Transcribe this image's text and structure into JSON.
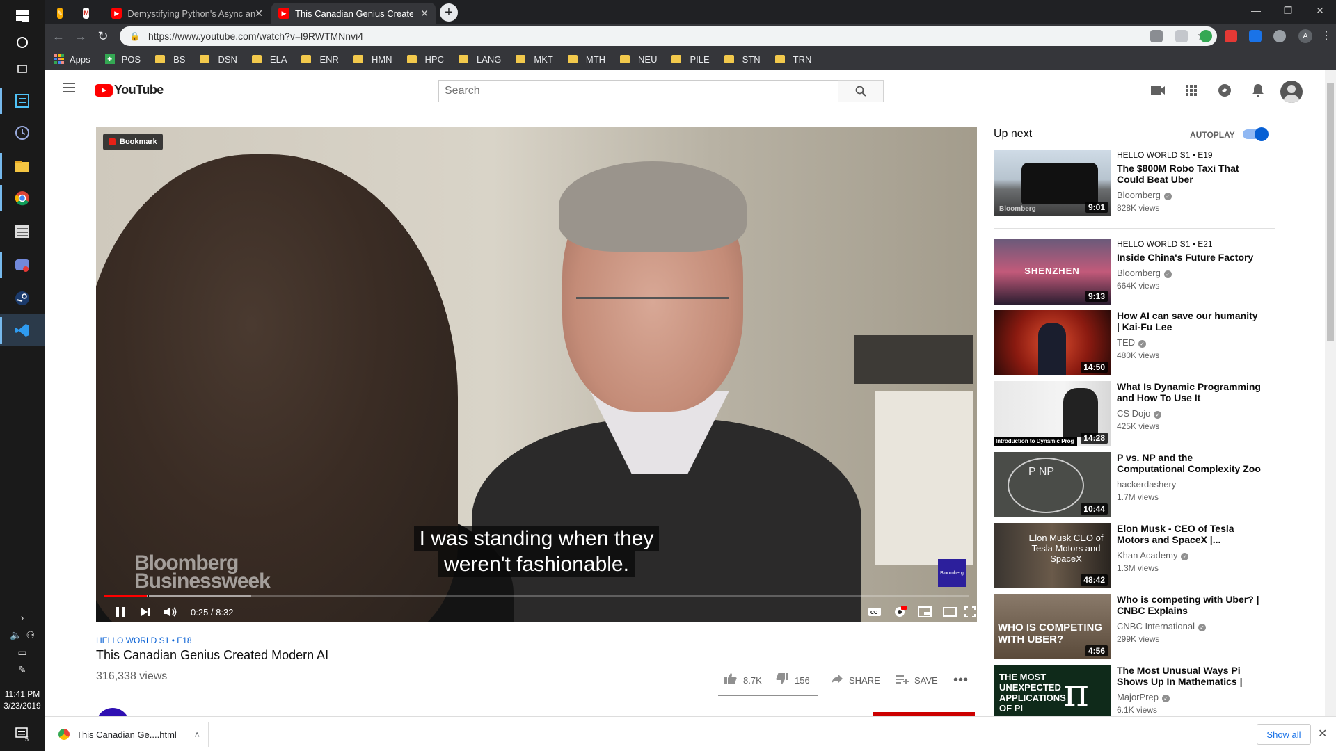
{
  "taskbar": {
    "time": "11:41 PM",
    "date": "3/23/2019",
    "notification_count": "5"
  },
  "browser": {
    "tabs": [
      {
        "label": "",
        "icon": "keep-icon"
      },
      {
        "label": "",
        "icon": "gmail-icon"
      },
      {
        "label": "Demystifying Python's Async and",
        "icon": "youtube-icon"
      },
      {
        "label": "This Canadian Genius Create",
        "icon": "youtube-icon"
      }
    ],
    "url": "https://www.youtube.com/watch?v=l9RWTMNnvi4",
    "bookmarks": [
      "Apps",
      "POS",
      "BS",
      "DSN",
      "ELA",
      "ENR",
      "HMN",
      "HPC",
      "LANG",
      "MKT",
      "MTH",
      "NEU",
      "PILE",
      "STN",
      "TRN"
    ],
    "profile_initial": "A"
  },
  "youtube": {
    "logo_text": "YouTube",
    "search_placeholder": "Search",
    "player": {
      "badge": "Bookmark",
      "caption_line1": "I was standing when they",
      "caption_line2": "weren't fashionable.",
      "watermark_line1": "Bloomberg",
      "watermark_line2": "Businessweek",
      "corner_logo": "Bloomberg",
      "time": "0:25 / 8:32",
      "progress_fraction": 0.049,
      "buffered_fraction": 0.17
    },
    "video": {
      "series": "HELLO WORLD  S1 • E18",
      "title": "This Canadian Genius Created Modern AI",
      "views": "316,338 views",
      "likes": "8.7K",
      "dislikes": "156",
      "share": "SHARE",
      "save": "SAVE"
    },
    "sidebar": {
      "up_next": "Up next",
      "autoplay": "AUTOPLAY",
      "videos": [
        {
          "ep": "HELLO WORLD  S1 • E19",
          "title": "The $800M Robo Taxi That Could Beat Uber",
          "channel": "Bloomberg",
          "views": "828K views",
          "duration": "9:01",
          "thumb_text": "Bloomberg"
        },
        {
          "ep": "HELLO WORLD  S1 • E21",
          "title": "Inside China's Future Factory",
          "channel": "Bloomberg",
          "views": "664K views",
          "duration": "9:13",
          "thumb_text": "SHENZHEN"
        },
        {
          "ep": "",
          "title": "How AI can save our humanity | Kai-Fu Lee",
          "channel": "TED",
          "views": "480K views",
          "duration": "14:50",
          "thumb_text": ""
        },
        {
          "ep": "",
          "title": "What Is Dynamic Programming and How To Use It",
          "channel": "CS Dojo",
          "views": "425K views",
          "duration": "14:28",
          "thumb_text": "Introduction to Dynamic Prog"
        },
        {
          "ep": "",
          "title": "P vs. NP and the Computational Complexity Zoo",
          "channel": "hackerdashery",
          "views": "1.7M views",
          "duration": "10:44",
          "thumb_text": "P  NP"
        },
        {
          "ep": "",
          "title": "Elon Musk - CEO of Tesla Motors and SpaceX |...",
          "channel": "Khan Academy",
          "views": "1.3M views",
          "duration": "48:42",
          "thumb_text": "Elon Musk CEO of Tesla Motors and SpaceX"
        },
        {
          "ep": "",
          "title": "Who is competing with Uber? | CNBC Explains",
          "channel": "CNBC International",
          "views": "299K views",
          "duration": "4:56",
          "thumb_text": "WHO IS COMPETING WITH UBER?"
        },
        {
          "ep": "",
          "title": "The Most Unusual Ways Pi Shows Up In Mathematics | Ca...",
          "channel": "MajorPrep",
          "views": "6.1K views",
          "duration": "",
          "thumb_text": "THE MOST UNEXPECTED APPLICATIONS OF PI"
        }
      ]
    },
    "colors": {
      "brand_red": "#ff0000",
      "link_blue": "#065fd4"
    }
  },
  "downloads": {
    "file": "This Canadian Ge....html",
    "show_all": "Show all"
  }
}
